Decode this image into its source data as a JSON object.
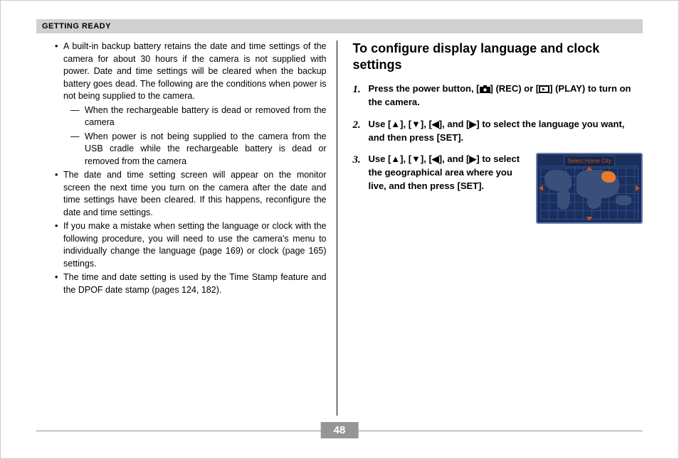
{
  "header": {
    "section": "GETTING READY"
  },
  "left": {
    "b1": "A built-in backup battery retains the date and time settings of the camera for about 30 hours if the camera is not supplied with power. Date and time settings will be cleared when the backup battery goes dead. The following are the conditions when power is not being supplied to the camera.",
    "b1d1": "When the rechargeable battery is dead or removed from the camera",
    "b1d2": "When power is not being supplied to the camera from the USB cradle while the rechargeable battery is dead or removed from the camera",
    "b2": "The date and time setting screen will appear on the monitor screen the next time you turn on the camera after the date and time settings have been cleared. If this happens, reconfigure the date and time settings.",
    "b3": "If you make a mistake when setting the language or clock with the following procedure, you will need to use the camera's menu to individually change the language (page 169) or clock (page 165) settings.",
    "b4": "The time and date setting is used by the Time Stamp feature and the DPOF date stamp (pages 124, 182)."
  },
  "right": {
    "title": "To configure display language and clock settings",
    "step1_a": "Press the power button, [",
    "step1_b": "] (REC) or [",
    "step1_c": "] (PLAY) to turn on the camera.",
    "step2": "Use [▲], [▼], [◀], and [▶] to select the language you want, and then press [SET].",
    "step3": "Use [▲], [▼], [◀], and [▶] to select the geographical area where you live, and then press [SET].",
    "map_title": "Select Home City"
  },
  "page": {
    "number": "48"
  }
}
